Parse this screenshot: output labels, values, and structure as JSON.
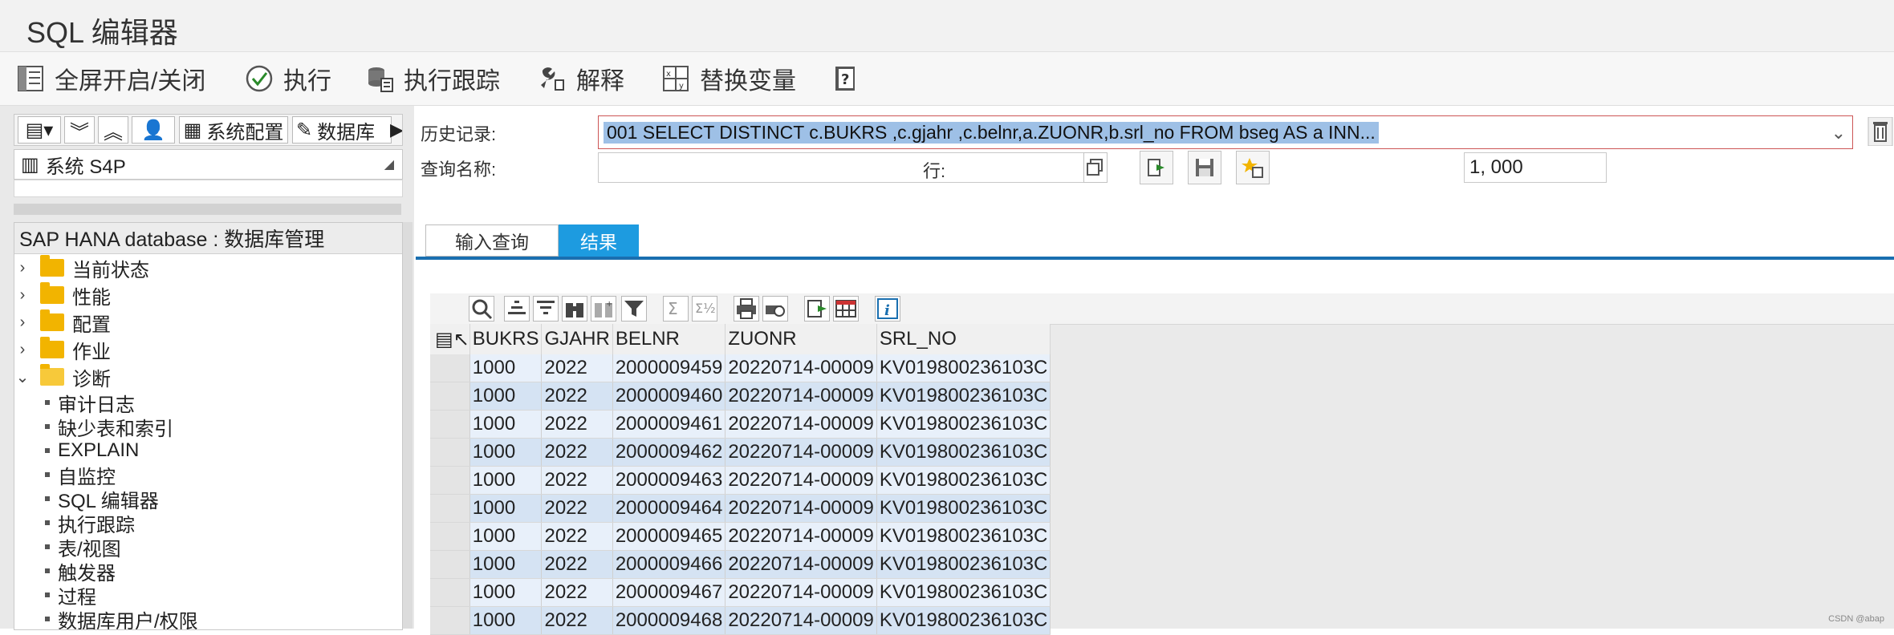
{
  "window": {
    "title": "SQL 编辑器"
  },
  "toolbar": {
    "fullscreen": "全屏开启/关闭",
    "execute": "执行",
    "trace": "执行跟踪",
    "explain": "解释",
    "replace_vars": "替换变量"
  },
  "left": {
    "toolbar": {
      "sys_config": "系统配置",
      "db": "数据库"
    },
    "system": "系统 S4P",
    "tree_header": "SAP HANA database : 数据库管理",
    "folders": [
      "当前状态",
      "性能",
      "配置",
      "作业",
      "诊断"
    ],
    "leaves": [
      "审计日志",
      "缺少表和索引",
      "EXPLAIN",
      "自监控",
      "SQL 编辑器",
      "执行跟踪",
      "表/视图",
      "触发器",
      "过程",
      "数据库用户/权限"
    ]
  },
  "form": {
    "history_label": "历史记录:",
    "history_value": "001 SELECT DISTINCT c.BUKRS ,c.gjahr ,c.belnr,a.ZUONR,b.srl_no FROM bseg AS a INN...",
    "query_name_label": "查询名称:",
    "rows_label": "行:",
    "rows_value": "1, 000"
  },
  "tabs": {
    "input": "输入查询",
    "result": "结果"
  },
  "grid": {
    "columns": [
      "BUKRS",
      "GJAHR",
      "BELNR",
      "ZUONR",
      "SRL_NO"
    ],
    "rows": [
      [
        "1000",
        "2022",
        "2000009459",
        "20220714-00009",
        "KV019800236103C"
      ],
      [
        "1000",
        "2022",
        "2000009460",
        "20220714-00009",
        "KV019800236103C"
      ],
      [
        "1000",
        "2022",
        "2000009461",
        "20220714-00009",
        "KV019800236103C"
      ],
      [
        "1000",
        "2022",
        "2000009462",
        "20220714-00009",
        "KV019800236103C"
      ],
      [
        "1000",
        "2022",
        "2000009463",
        "20220714-00009",
        "KV019800236103C"
      ],
      [
        "1000",
        "2022",
        "2000009464",
        "20220714-00009",
        "KV019800236103C"
      ],
      [
        "1000",
        "2022",
        "2000009465",
        "20220714-00009",
        "KV019800236103C"
      ],
      [
        "1000",
        "2022",
        "2000009466",
        "20220714-00009",
        "KV019800236103C"
      ],
      [
        "1000",
        "2022",
        "2000009467",
        "20220714-00009",
        "KV019800236103C"
      ],
      [
        "1000",
        "2022",
        "2000009468",
        "20220714-00009",
        "KV019800236103C"
      ]
    ]
  },
  "watermark": "CSDN @abap",
  "colors": {
    "accent": "#1d9be0",
    "tab_line": "#1a6fb0",
    "folder": "#f2b400",
    "selection": "#9ec0e6"
  }
}
